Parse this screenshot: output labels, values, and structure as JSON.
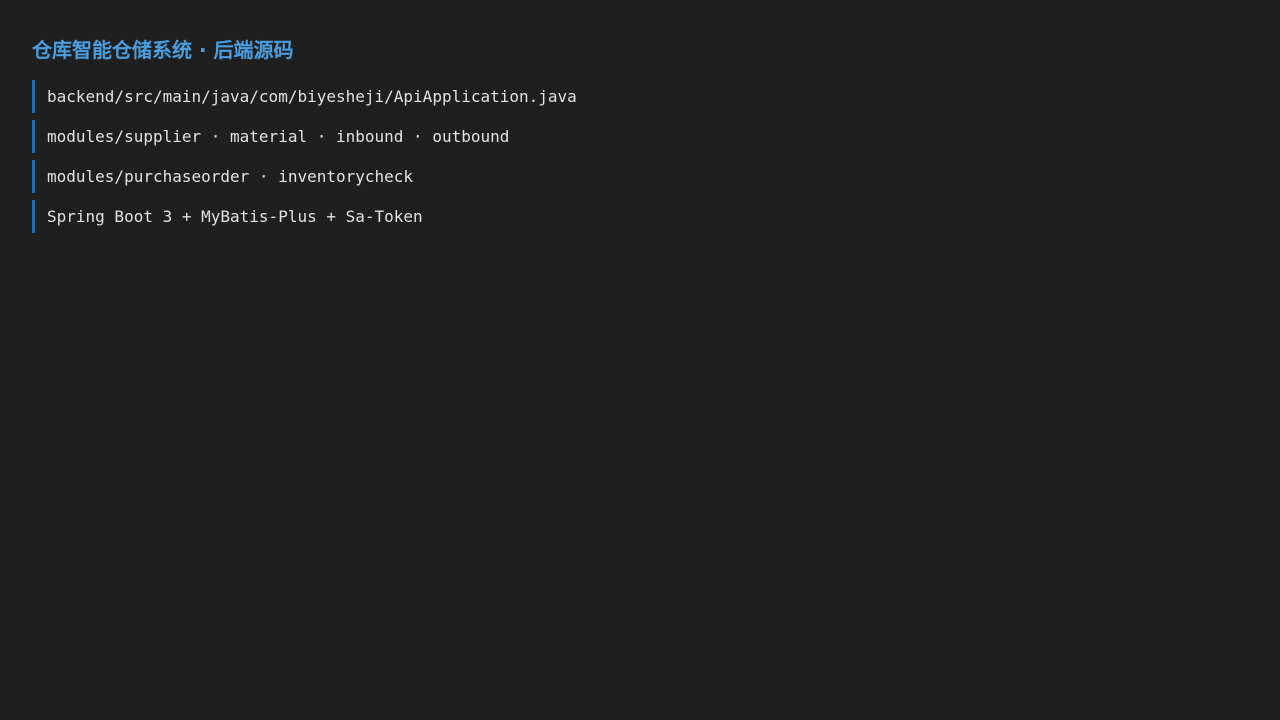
{
  "page": {
    "title": "仓库智能仓储系统 · 后端源码",
    "lines": [
      "backend/src/main/java/com/biyesheji/ApiApplication.java",
      "modules/supplier · material · inbound · outbound",
      "modules/purchaseorder · inventorycheck",
      "Spring Boot 3 + MyBatis-Plus + Sa-Token"
    ]
  },
  "colors": {
    "background": "#1f1f1f",
    "title": "#4a9ee0",
    "accent_bar": "#1d6fb0",
    "text": "#e2e2e2"
  }
}
